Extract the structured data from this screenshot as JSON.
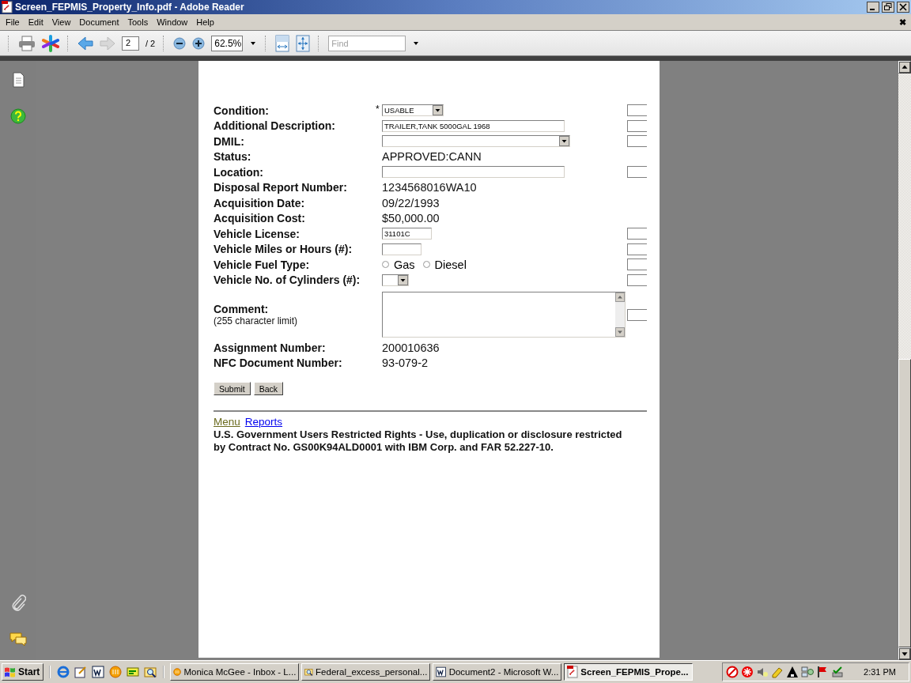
{
  "window": {
    "title": "Screen_FEPMIS_Property_Info.pdf - Adobe Reader"
  },
  "menu": {
    "items": [
      "File",
      "Edit",
      "View",
      "Document",
      "Tools",
      "Window",
      "Help"
    ],
    "close_glyph": "✖"
  },
  "toolbar": {
    "page": "2",
    "page_total": "/ 2",
    "zoom": "62.5%",
    "find": {
      "placeholder": "Find"
    }
  },
  "form": {
    "rows": [
      {
        "label": "Condition:",
        "kind": "select",
        "required_mark": "*",
        "value": "USABLE",
        "side_box": true
      },
      {
        "label": "Additional Description:",
        "kind": "text",
        "value": "TRAILER,TANK 5000GAL 1968",
        "side_box": true
      },
      {
        "label": "DMIL:",
        "kind": "select",
        "side_box": true
      },
      {
        "label": "Status:",
        "kind": "static",
        "value": "APPROVED:CANN",
        "side_box": false
      },
      {
        "label": "Location:",
        "kind": "text",
        "side_box": true
      },
      {
        "label": "Disposal Report Number:",
        "kind": "static",
        "value": "1234568016WA10",
        "side_box": false
      },
      {
        "label": "Acquisition Date:",
        "kind": "static",
        "value": "09/22/1993",
        "side_box": false
      },
      {
        "label": "Acquisition Cost:",
        "kind": "static",
        "value": "$50,000.00",
        "side_box": false
      },
      {
        "label": "Vehicle License:",
        "kind": "text",
        "value": "31101C",
        "side_box": true
      },
      {
        "label": "Vehicle Miles or Hours (#):",
        "kind": "text",
        "side_box": true
      },
      {
        "label": "Vehicle Fuel Type:",
        "kind": "radio",
        "options": [
          {
            "label": "Gas",
            "checked": false
          },
          {
            "label": "Diesel",
            "checked": false
          }
        ],
        "side_box": true
      },
      {
        "label": "Vehicle No. of Cylinders (#):",
        "kind": "select",
        "side_box": true
      },
      {
        "label": "Comment:",
        "note": "(255 character limit)",
        "kind": "textarea",
        "side_box": true
      },
      {
        "label": "Assignment Number:",
        "kind": "static",
        "value": "200010636",
        "side_box": false
      },
      {
        "label": "NFC Document Number:",
        "kind": "static",
        "value": "93-079-2",
        "side_box": false
      }
    ],
    "buttons": [
      "Submit",
      "Back"
    ]
  },
  "footer": {
    "links": [
      {
        "label": "Menu",
        "visited": true
      },
      {
        "label": "Reports",
        "visited": false
      }
    ],
    "notice": "U.S. Government Users Restricted Rights - Use, duplication or disclosure restricted by Contract No. GS00K94ALD0001 with IBM Corp. and FAR 52.227-10."
  },
  "taskbar": {
    "start": "Start",
    "tasks": [
      {
        "label": "Monica McGee - Inbox - L...",
        "selected": false
      },
      {
        "label": "Federal_excess_personal...",
        "selected": false
      },
      {
        "label": "Document2 - Microsoft W...",
        "selected": false
      },
      {
        "label": "Screen_FEPMIS_Prope...",
        "selected": true
      }
    ],
    "time": "2:31 PM"
  }
}
